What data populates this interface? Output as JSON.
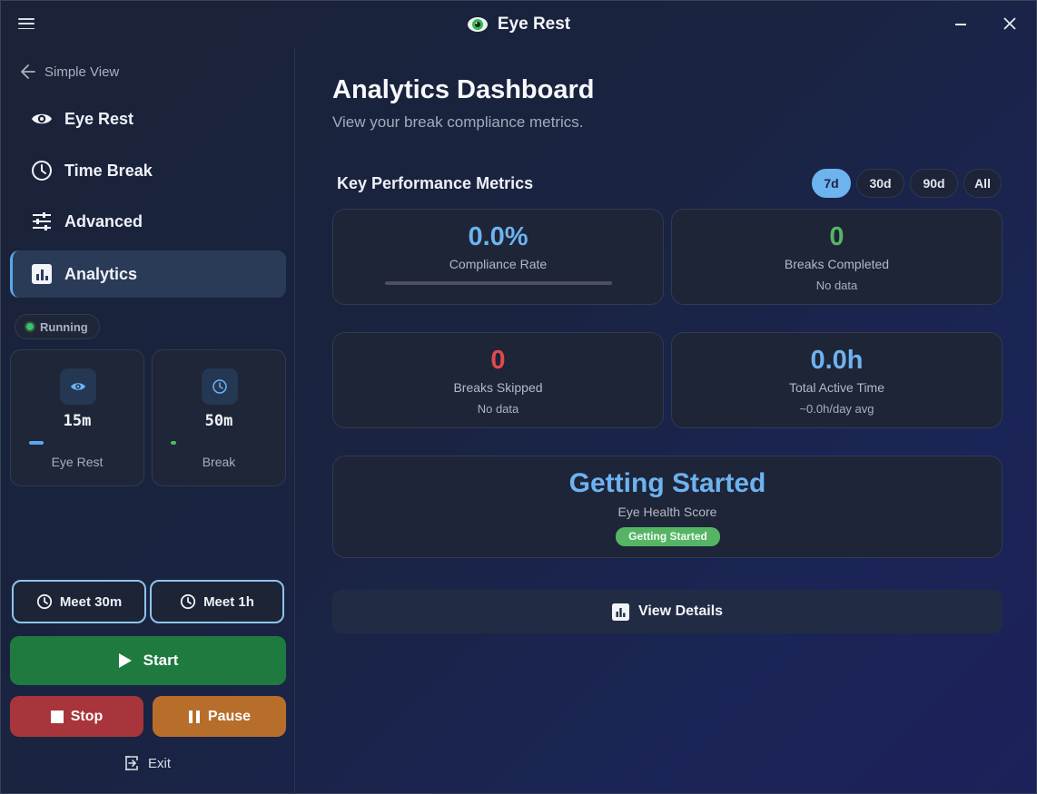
{
  "window": {
    "title": "Eye Rest"
  },
  "sidebar": {
    "back_label": "Simple View",
    "nav": [
      {
        "label": "Eye Rest",
        "icon": "eye-icon"
      },
      {
        "label": "Time Break",
        "icon": "clock-icon"
      },
      {
        "label": "Advanced",
        "icon": "sliders-icon"
      },
      {
        "label": "Analytics",
        "icon": "bar-chart-icon",
        "active": true
      }
    ],
    "status": "Running",
    "timers": [
      {
        "value": "15m",
        "label": "Eye Rest",
        "icon": "eye-icon",
        "color": "#5aa7ec",
        "progress": 0.15
      },
      {
        "value": "50m",
        "label": "Break",
        "icon": "clock-icon",
        "color": "#4cb86a",
        "progress": 0.05
      }
    ],
    "meet_30": "Meet 30m",
    "meet_1h": "Meet 1h",
    "start": "Start",
    "stop": "Stop",
    "pause": "Pause",
    "exit": "Exit"
  },
  "main": {
    "title": "Analytics Dashboard",
    "subtitle": "View your break compliance metrics.",
    "section_title": "Key Performance Metrics",
    "ranges": [
      "7d",
      "30d",
      "90d",
      "All"
    ],
    "active_range": "7d",
    "metrics": {
      "compliance": {
        "value": "0.0%",
        "label": "Compliance Rate",
        "color": "#6db3f0",
        "progress": 0.0
      },
      "completed": {
        "value": "0",
        "label": "Breaks Completed",
        "sub": "No data",
        "color": "#56b565"
      },
      "skipped": {
        "value": "0",
        "label": "Breaks Skipped",
        "sub": "No data",
        "color": "#e04a4a"
      },
      "active_time": {
        "value": "0.0h",
        "label": "Total Active Time",
        "sub": "~0.0h/day avg",
        "color": "#6db3f0"
      }
    },
    "health": {
      "value": "Getting Started",
      "label": "Eye Health Score",
      "badge": "Getting Started"
    },
    "details_button": "View Details"
  }
}
